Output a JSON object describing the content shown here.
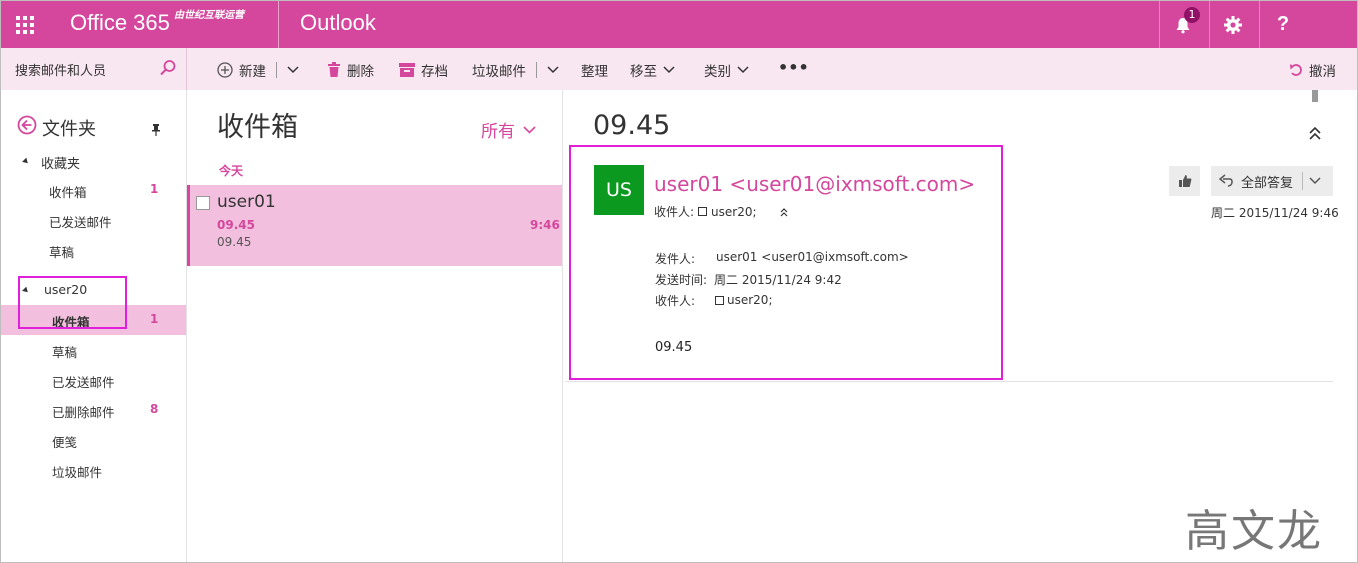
{
  "topbar": {
    "brand": "Office 365",
    "brand_sub": "由世纪互联运营",
    "app_name": "Outlook",
    "notification_count": "1",
    "colors": {
      "brand": "#d5479d",
      "badge": "#8f1266"
    }
  },
  "search": {
    "placeholder": "搜索邮件和人员"
  },
  "commands": {
    "new": "新建",
    "delete": "删除",
    "archive": "存档",
    "junk": "垃圾邮件",
    "sweep": "整理",
    "move_to": "移至",
    "categories": "类别",
    "more": "•••",
    "undo": "撤消"
  },
  "folders": {
    "title": "文件夹",
    "favorites": {
      "label": "收藏夹",
      "items": [
        {
          "label": "收件箱",
          "count": "1"
        },
        {
          "label": "已发送邮件",
          "count": ""
        },
        {
          "label": "草稿",
          "count": ""
        }
      ]
    },
    "account": {
      "label": "user20",
      "items": [
        {
          "label": "收件箱",
          "count": "1"
        },
        {
          "label": "草稿",
          "count": ""
        },
        {
          "label": "已发送邮件",
          "count": ""
        },
        {
          "label": "已删除邮件",
          "count": "8"
        },
        {
          "label": "便笺",
          "count": ""
        },
        {
          "label": "垃圾邮件",
          "count": ""
        }
      ]
    }
  },
  "message_list": {
    "title": "收件箱",
    "filter": "所有",
    "group_label": "今天",
    "messages": [
      {
        "from": "user01",
        "subject": "09.45",
        "preview": "09.45",
        "time": "9:46"
      }
    ]
  },
  "reading": {
    "subject": "09.45",
    "avatar_initials": "US",
    "avatar_color": "#0b9a1f",
    "sender": "user01 <user01@ixmsoft.com>",
    "to_label": "收件人:",
    "to_value": "user20;",
    "reply_all": "全部答复",
    "date": "周二 2015/11/24 9:46",
    "meta": {
      "from_label": "发件人:",
      "from_value": "user01 <user01@ixmsoft.com>",
      "sent_label": "发送时间:",
      "sent_value": "周二 2015/11/24 9:42",
      "to_label": "收件人:",
      "to_value": "user20;"
    },
    "body": "09.45"
  },
  "watermark": "高文龙"
}
